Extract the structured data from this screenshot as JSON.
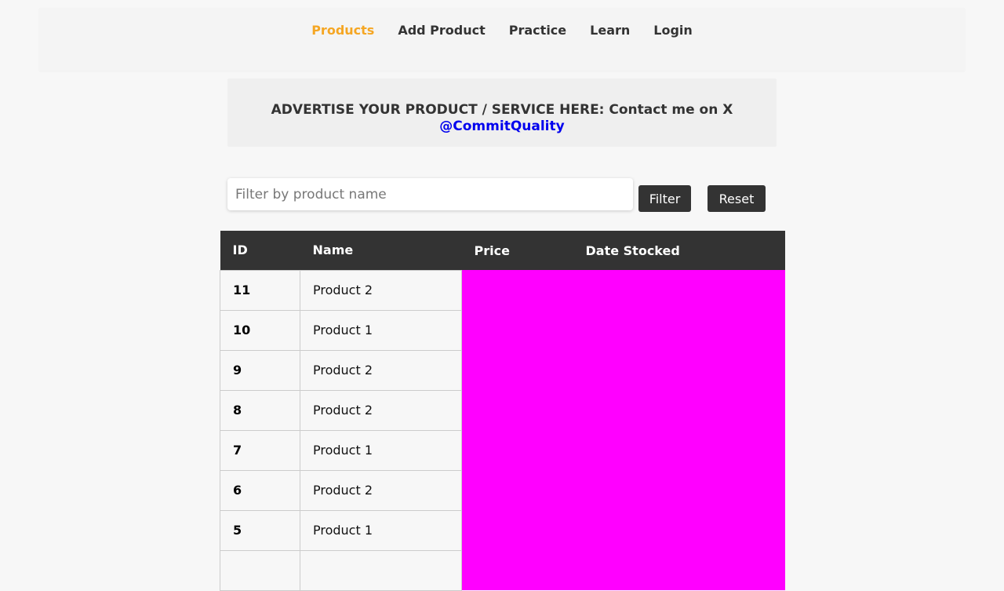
{
  "nav": {
    "items": [
      {
        "label": "Products",
        "active": true
      },
      {
        "label": "Add Product",
        "active": false
      },
      {
        "label": "Practice",
        "active": false
      },
      {
        "label": "Learn",
        "active": false
      },
      {
        "label": "Login",
        "active": false
      }
    ],
    "active_color": "#f5a623"
  },
  "banner": {
    "text": "ADVERTISE YOUR PRODUCT / SERVICE HERE: Contact me on X",
    "link": "@CommitQuality",
    "link_color": "#0000ee"
  },
  "filter": {
    "placeholder": "Filter by product name",
    "value": "",
    "filter_label": "Filter",
    "reset_label": "Reset"
  },
  "table": {
    "headers": [
      "ID",
      "Name",
      "Price",
      "Date Stocked"
    ],
    "rows": [
      {
        "id": "11",
        "name": "Product 2"
      },
      {
        "id": "10",
        "name": "Product 1"
      },
      {
        "id": "9",
        "name": "Product 2"
      },
      {
        "id": "8",
        "name": "Product 2"
      },
      {
        "id": "7",
        "name": "Product 1"
      },
      {
        "id": "6",
        "name": "Product 2"
      },
      {
        "id": "5",
        "name": "Product 1"
      },
      {
        "id": "",
        "name": ""
      }
    ],
    "redacted_color": "#ff00ff"
  }
}
